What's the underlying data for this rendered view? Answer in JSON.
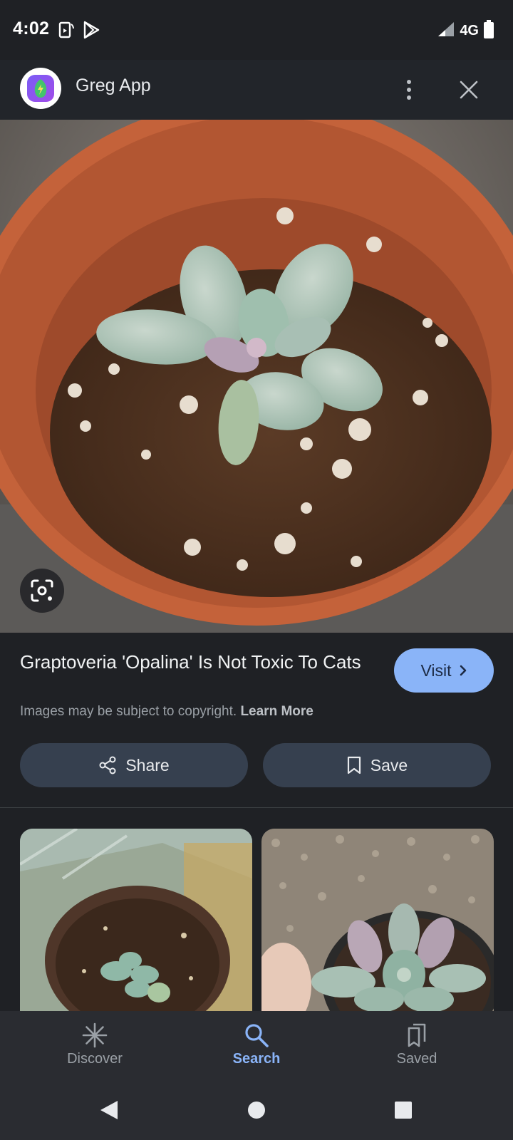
{
  "status_bar": {
    "time": "4:02",
    "network": "4G",
    "icons": [
      "screen-rotate-icon",
      "play-store-icon",
      "signal-icon",
      "battery-icon"
    ]
  },
  "app_header": {
    "title": "Greg App",
    "logo_icon": "leaf-bolt-icon",
    "menu_icon": "more-vert-icon",
    "close_icon": "close-icon"
  },
  "result": {
    "title": "Graptoveria 'Opalina' Is Not Toxic To Cats",
    "visit_label": "Visit",
    "copyright_text": "Images may be subject to copyright.",
    "learn_more": "Learn More",
    "share_label": "Share",
    "save_label": "Save"
  },
  "bottom_nav": {
    "items": [
      {
        "label": "Discover",
        "icon": "asterisk-icon",
        "active": false
      },
      {
        "label": "Search",
        "icon": "search-icon",
        "active": true
      },
      {
        "label": "Saved",
        "icon": "bookmarks-icon",
        "active": false
      }
    ]
  },
  "colors": {
    "background": "#1f2125",
    "accent": "#8ab4f8",
    "pill": "#36404f",
    "nav_bg": "#2a2c31"
  }
}
